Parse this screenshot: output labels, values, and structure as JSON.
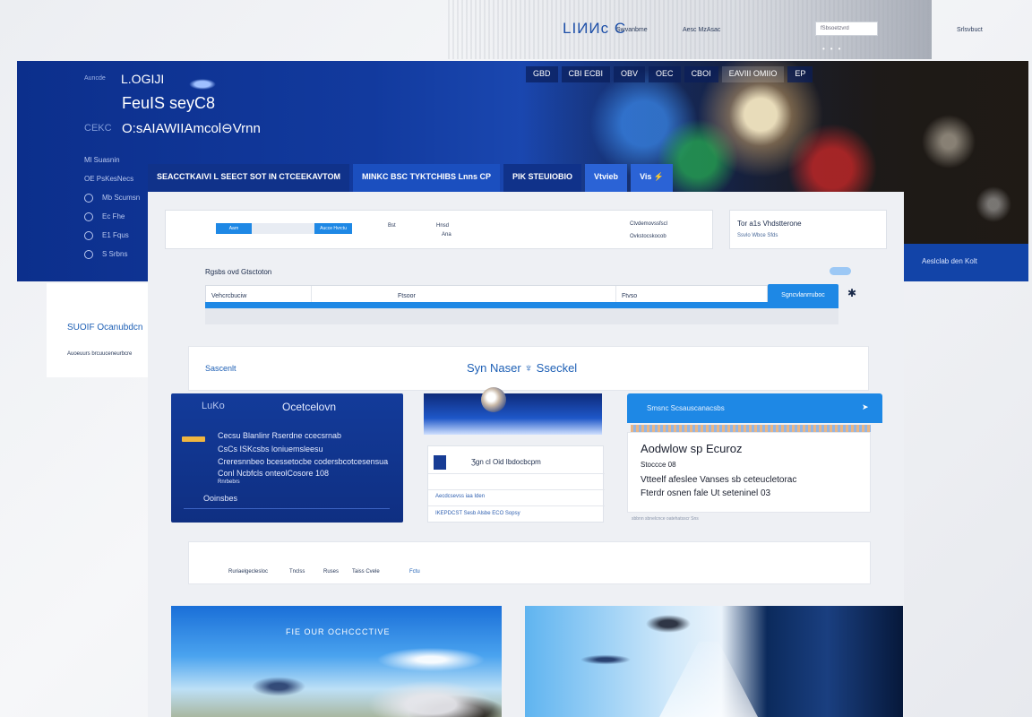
{
  "topbar": {
    "brand": "LIИИc C",
    "brand_sub": "Swvanbme",
    "links": "Aesc  MzAsac",
    "search_placeholder": "fSbsoetzvrd",
    "right_link": "Srlsvbuct"
  },
  "hero": {
    "small_label": "Auncde",
    "login": "L.OGIJI",
    "headline1": "FeuIS seyC8",
    "headline2_pre": "CEKC",
    "headline2": "O:sAIAWIIAmcol⊖Vrnn",
    "nav": [
      {
        "label": "Ml Suasnin"
      },
      {
        "label": "OE PsKesNecs"
      },
      {
        "label": "Mb  Scumsn"
      },
      {
        "label": "Ec  Fhe"
      },
      {
        "label": "E1  Fqus"
      },
      {
        "label": "S   Srbns"
      }
    ],
    "menu": [
      "GBD",
      "CBI ECBI",
      "OBV",
      "OEC",
      "CBOI",
      "EAVIII OMIIO",
      "EP"
    ],
    "band_text": "Aeslclab den Kolt"
  },
  "tabs": [
    {
      "label": "SEACCTKAIVI  L   SEECT SOT IN CTCEEKAVTOM",
      "style": "dark"
    },
    {
      "label": "MINKC  BSC TYKTCHIBS    Lnns    CP",
      "style": "normal"
    },
    {
      "label": "PIK STEUIOBIO",
      "style": "dark"
    },
    {
      "label": "Vtvieb",
      "style": "light"
    },
    {
      "label": "Vis  ⚡",
      "style": "light"
    }
  ],
  "toolbar": {
    "btn1": "Aarn",
    "btn2": "Aucce Hvrctu",
    "t1": "Bst",
    "t2": "Hnsd",
    "t3": "Ana",
    "t4": "Ctvdemovssfscl",
    "t5": "Ovkstocskocob",
    "right_title": "Tor a1s  Vhdstterone",
    "right_sub": "Ssvlo   Wbce   Sfds"
  },
  "search": {
    "label": "Rgsbs ovd Gtsctoton",
    "cells": [
      "Vehcrcbuciw",
      "Ftsoor",
      "Ftvso"
    ],
    "button": "Sgncvlanrruboc"
  },
  "section": {
    "left": "Sascenlt",
    "title": "Syn Naser ♆ Sseckel"
  },
  "card_dark": {
    "pre": "LuKo",
    "title": "Ocetcelovn",
    "items": [
      "Cecsu  Blanlinr  Rserdne  ccecsrnab",
      "CsCs ISKcsbs loniuemsleesu",
      "Creresnnbeo bcessetocbe codersbcotcesensua",
      "Conl Ncbfcls               onteolCosore 108",
      "Rnrbebrs",
      "Ooinsbes"
    ]
  },
  "card_mid": {
    "title": "Ʒgn cl  Oid Ibdocbcpm",
    "rows": [
      "Aecdcsevss iaa Iden",
      "IKEPDCST   Sesb Alsbe ECO Sopsy"
    ]
  },
  "card_right": {
    "header": "Smsnc Scsauscanacsbs",
    "line1": "Aodwlow  sp  Ecuroz",
    "line2": "Stoccce 08",
    "line3": "Vtteelf afeslee Vanses sb ceteucletorac",
    "line4": "Fterdr osnen  fale Ut seteninel  03",
    "foot": "sbbnn sbnelcnce oatehatsscr Sns"
  },
  "stats": [
    "Ruriaelgeclesloc",
    "Tnclss",
    "Ruses",
    "Taiss Cvele",
    "Fctu"
  ],
  "images": {
    "left_caption": "FIE OUR OCHCCCTIVE"
  },
  "side_widget": {
    "title": "SUOIF Ocanubdcn",
    "sub": "Auoeuurs brcuuceneurbcre"
  },
  "colors": {
    "hero_blue": "#123a9e",
    "accent_blue": "#1e88e5",
    "panel_bg": "#eef0f4"
  }
}
